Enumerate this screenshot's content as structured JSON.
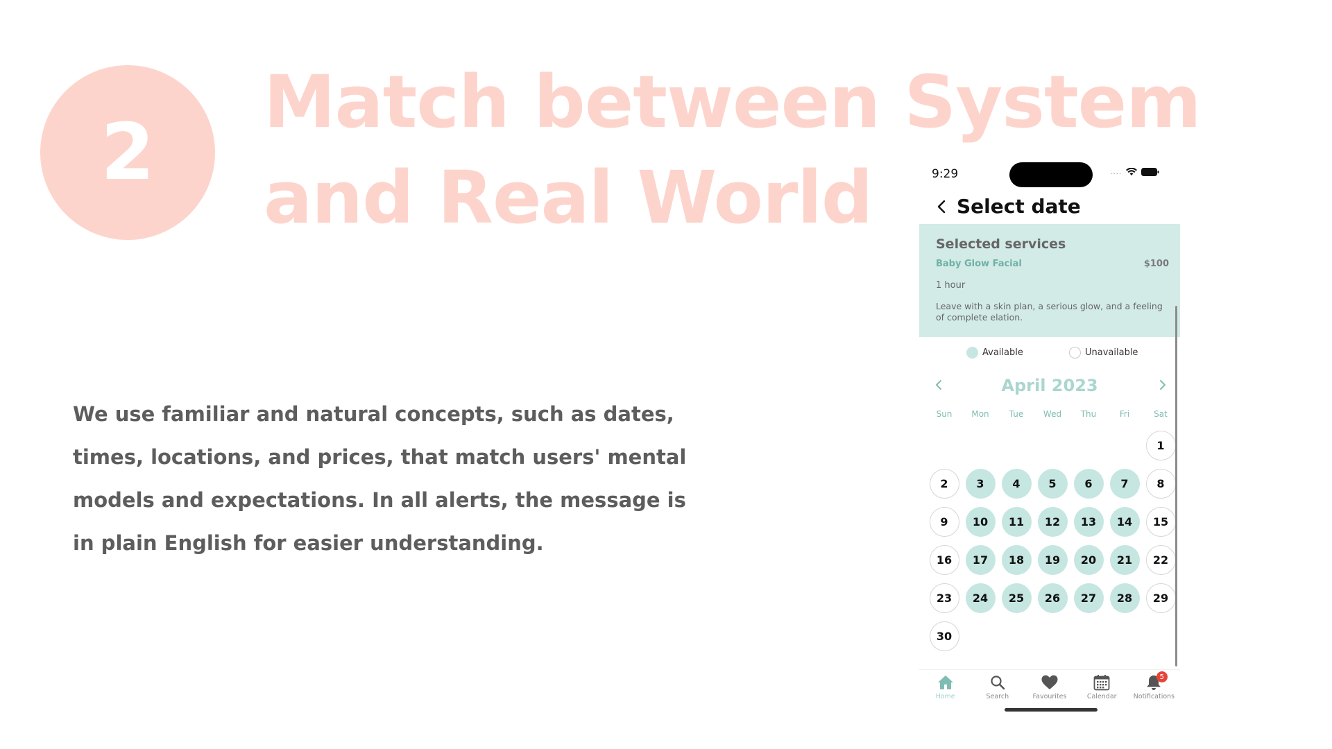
{
  "slide": {
    "number": "2",
    "title_line1": "Match between System",
    "title_line2": "and Real World",
    "body": "We use familiar and natural concepts, such as dates, times, locations, and prices, that match users' mental models and expectations. In all alerts, the message is in plain English for easier understanding.",
    "accent_color": "#fdd4cc",
    "body_color": "#5d5d5d"
  },
  "phone": {
    "status": {
      "time": "9:29",
      "dots": "...."
    },
    "nav": {
      "title": "Select date",
      "back_icon": "chevron-left-icon"
    },
    "services": {
      "title": "Selected services",
      "name": "Baby Glow Facial",
      "price": "$100",
      "duration": "1 hour",
      "description": "Leave with a skin plan, a serious glow, and a feeling of complete elation.",
      "background": "#d2ebe7"
    },
    "legend": {
      "available": "Available",
      "unavailable": "Unavailable"
    },
    "calendar": {
      "month": "April 2023",
      "weekdays": [
        "Sun",
        "Mon",
        "Tue",
        "Wed",
        "Thu",
        "Fri",
        "Sat"
      ],
      "first_weekday_index": 6,
      "available_color": "#c5e6e1",
      "days": [
        {
          "d": "1",
          "available": false
        },
        {
          "d": "2",
          "available": false
        },
        {
          "d": "3",
          "available": true
        },
        {
          "d": "4",
          "available": true
        },
        {
          "d": "5",
          "available": true
        },
        {
          "d": "6",
          "available": true
        },
        {
          "d": "7",
          "available": true
        },
        {
          "d": "8",
          "available": false
        },
        {
          "d": "9",
          "available": false
        },
        {
          "d": "10",
          "available": true
        },
        {
          "d": "11",
          "available": true
        },
        {
          "d": "12",
          "available": true
        },
        {
          "d": "13",
          "available": true
        },
        {
          "d": "14",
          "available": true
        },
        {
          "d": "15",
          "available": false
        },
        {
          "d": "16",
          "available": false
        },
        {
          "d": "17",
          "available": true
        },
        {
          "d": "18",
          "available": true
        },
        {
          "d": "19",
          "available": true
        },
        {
          "d": "20",
          "available": true
        },
        {
          "d": "21",
          "available": true
        },
        {
          "d": "22",
          "available": false
        },
        {
          "d": "23",
          "available": false
        },
        {
          "d": "24",
          "available": true
        },
        {
          "d": "25",
          "available": true
        },
        {
          "d": "26",
          "available": true
        },
        {
          "d": "27",
          "available": true
        },
        {
          "d": "28",
          "available": true
        },
        {
          "d": "29",
          "available": false
        },
        {
          "d": "30",
          "available": false
        }
      ]
    },
    "tabs": [
      {
        "label": "Home",
        "icon": "home-icon",
        "active": true
      },
      {
        "label": "Search",
        "icon": "search-icon",
        "active": false
      },
      {
        "label": "Favourites",
        "icon": "heart-icon",
        "active": false
      },
      {
        "label": "Calendar",
        "icon": "calendar-icon",
        "active": false
      },
      {
        "label": "Notifications",
        "icon": "bell-icon",
        "active": false,
        "badge": "5"
      }
    ]
  }
}
